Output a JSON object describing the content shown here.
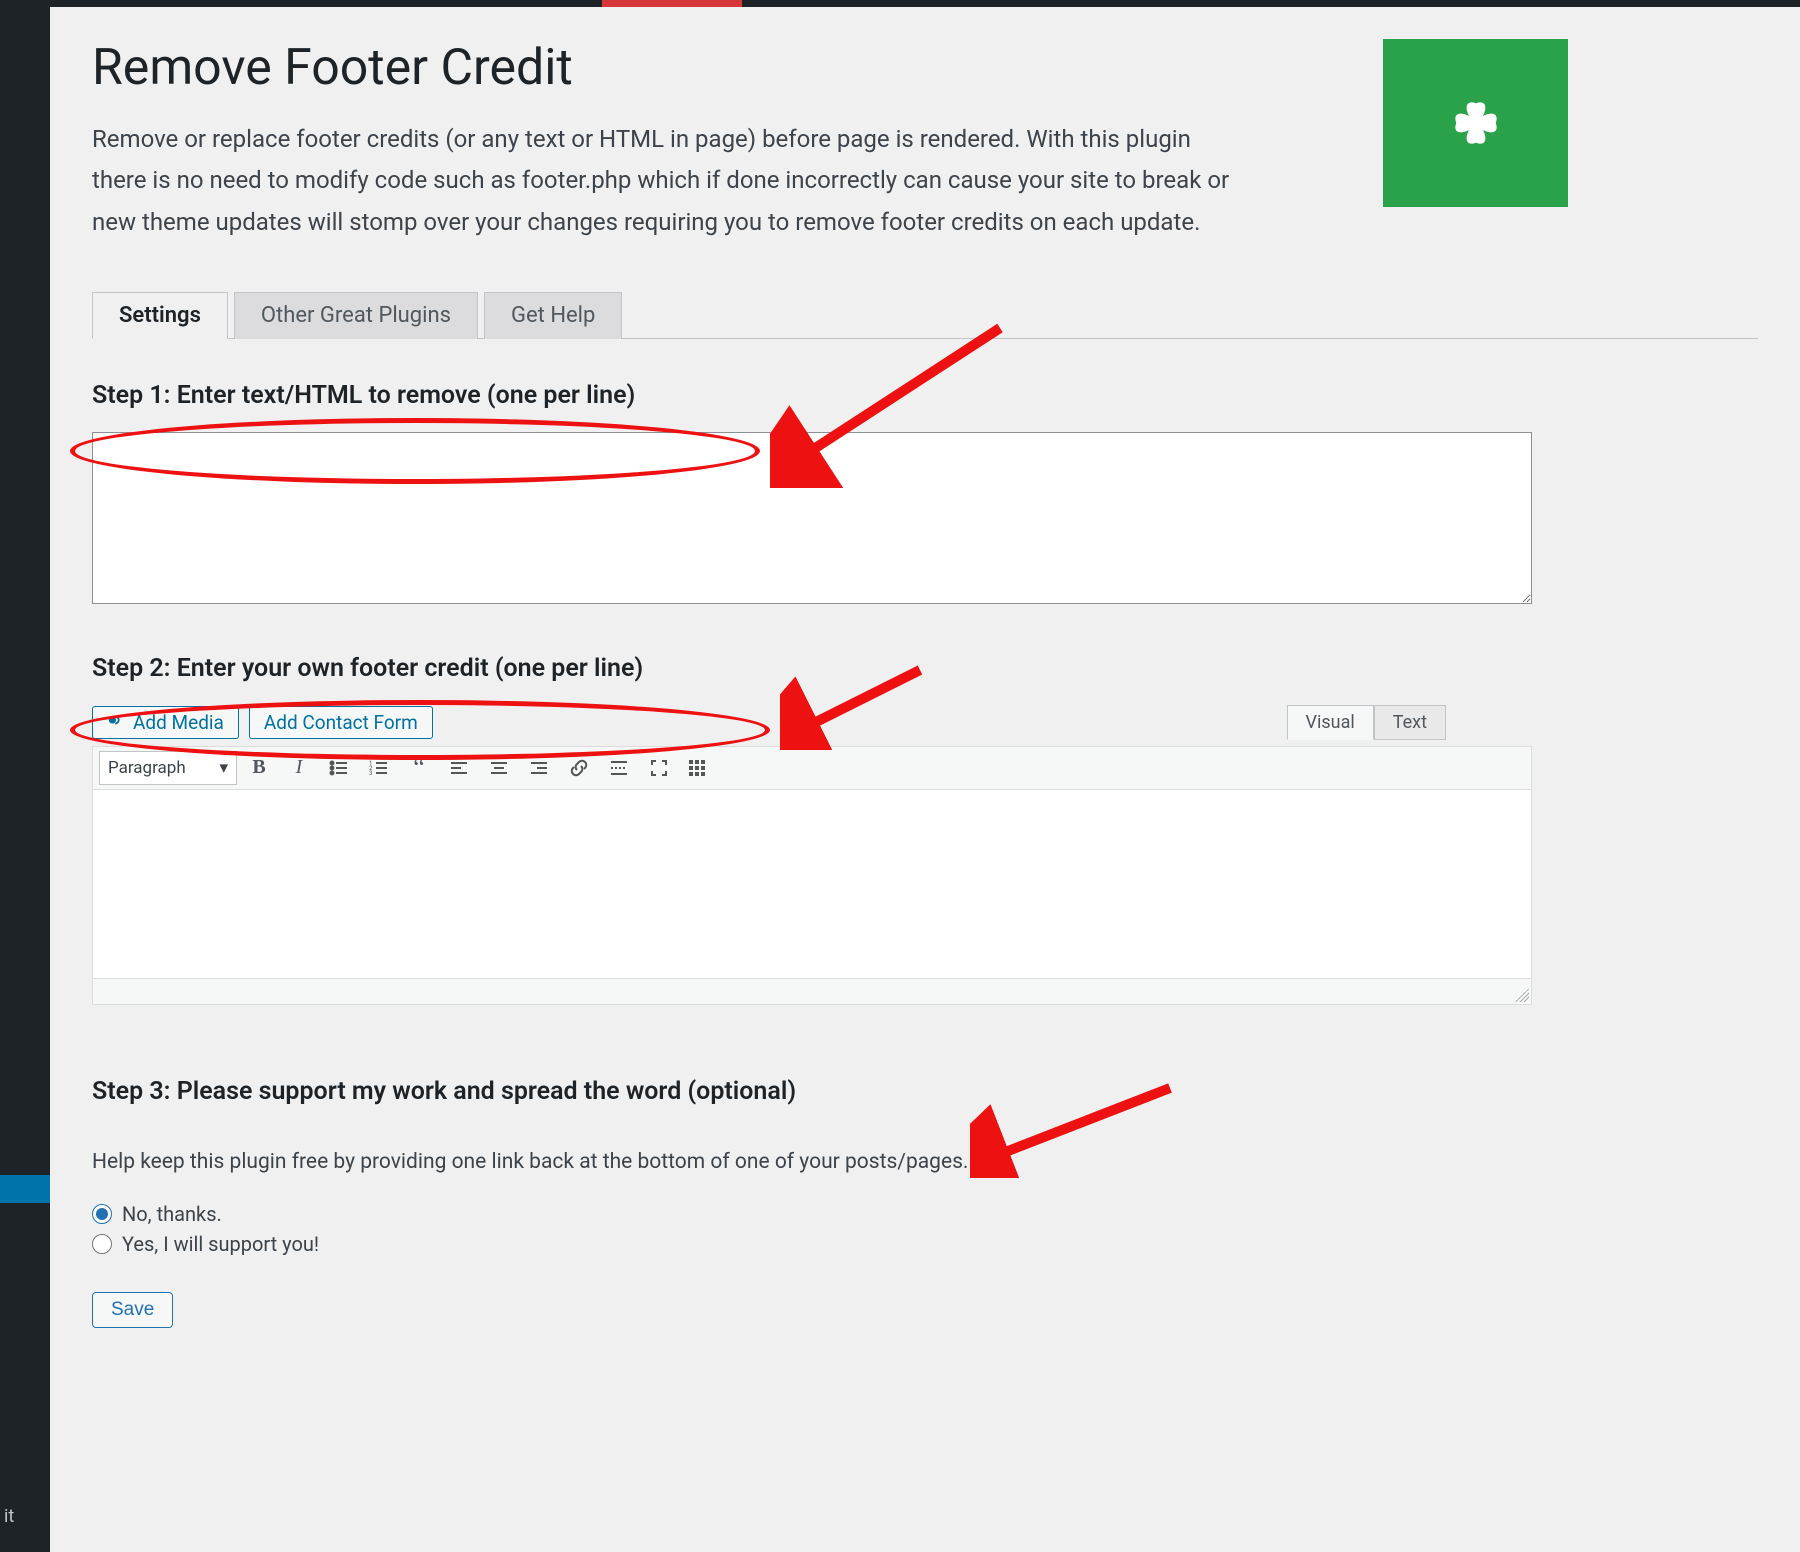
{
  "sidebar": {
    "active_item_fragment": "it"
  },
  "header": {
    "title": "Remove Footer Credit",
    "description": "Remove or replace footer credits (or any text or HTML in page) before page is rendered. With this plugin there is no need to modify code such as footer.php which if done incorrectly can cause your site to break or new theme updates will stomp over your changes requiring you to remove footer credits on each update."
  },
  "tabs": {
    "settings": "Settings",
    "other": "Other Great Plugins",
    "help": "Get Help"
  },
  "step1": {
    "heading": "Step 1: Enter text/HTML to remove (one per line)",
    "value": ""
  },
  "step2": {
    "heading": "Step 2: Enter your own footer credit (one per line)",
    "add_media": "Add Media",
    "add_contact_form": "Add Contact Form",
    "visual": "Visual",
    "text": "Text",
    "format_select": "Paragraph"
  },
  "step3": {
    "heading": "Step 3: Please support my work and spread the word (optional)",
    "support_text": "Help keep this plugin free by providing one link back at the bottom of one of your posts/pages.",
    "no_label": "No, thanks.",
    "yes_label": "Yes, I will support you!",
    "selected": "no"
  },
  "save_button": "Save",
  "colors": {
    "accent": "#2271b1",
    "brand_green": "#2aa24a",
    "annotation": "#e11"
  }
}
